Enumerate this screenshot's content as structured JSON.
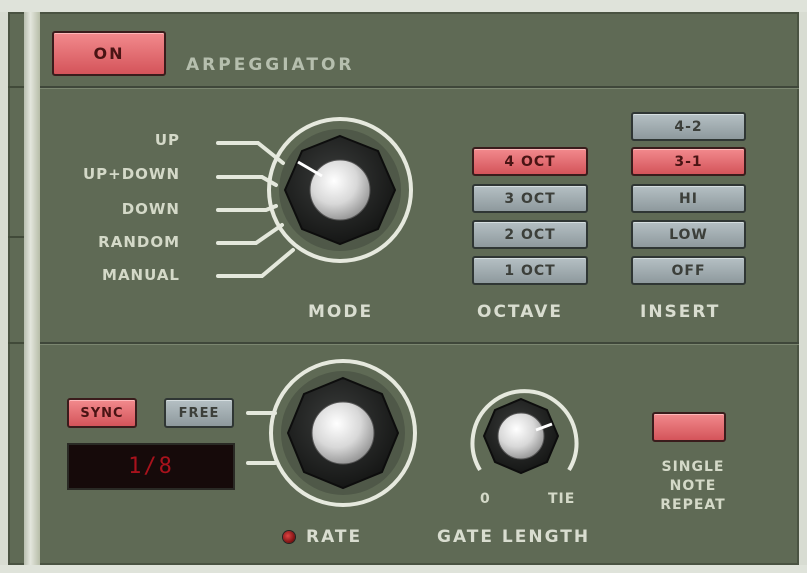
{
  "header": {
    "on_label": "ON",
    "title": "ARPEGGIATOR"
  },
  "mode": {
    "label": "MODE",
    "options": [
      "UP",
      "UP+DOWN",
      "DOWN",
      "RANDOM",
      "MANUAL"
    ],
    "selected": "UP"
  },
  "octave": {
    "label": "OCTAVE",
    "buttons": [
      "4 OCT",
      "3 OCT",
      "2 OCT",
      "1 OCT"
    ],
    "selected": "4 OCT"
  },
  "insert": {
    "label": "INSERT",
    "buttons": [
      "4-2",
      "3-1",
      "HI",
      "LOW",
      "OFF"
    ],
    "selected": "3-1"
  },
  "rate": {
    "label": "RATE",
    "sync_label": "SYNC",
    "free_label": "FREE",
    "selected": "SYNC",
    "display_value": "1/8"
  },
  "gate": {
    "label": "GATE LENGTH",
    "min_label": "0",
    "max_label": "TIE"
  },
  "single_note_repeat": {
    "label_line1": "SINGLE",
    "label_line2": "NOTE",
    "label_line3": "REPEAT"
  },
  "colors": {
    "panel": "#5f6a55",
    "button_active": "#e06d72",
    "button_inactive": "#a3aeb2",
    "display_text": "#a8121c"
  }
}
